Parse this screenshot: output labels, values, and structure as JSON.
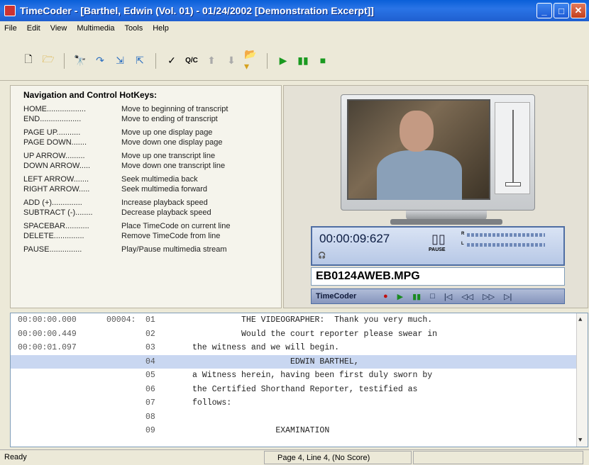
{
  "window": {
    "title": "TimeCoder - [Barthel, Edwin (Vol. 01) - 01/24/2002 [Demonstration Excerpt]]"
  },
  "menu": [
    "File",
    "Edit",
    "View",
    "Multimedia",
    "Tools",
    "Help"
  ],
  "toolbar_icons": [
    "new-document-icon",
    "open-folder-icon",
    "find-icon",
    "goto-icon",
    "next-icon",
    "prev-icon",
    "check-icon",
    "qc-icon",
    "up-arrow-icon",
    "down-arrow-icon",
    "folder-dropdown-icon",
    "play-icon",
    "pause-icon",
    "stop-icon"
  ],
  "toolbar": {
    "qc_label": "Q/C"
  },
  "navigation": {
    "title": "Navigation and Control HotKeys:",
    "groups": [
      [
        {
          "key": "HOME..................",
          "desc": "Move to beginning of transcript"
        },
        {
          "key": "END...................",
          "desc": "Move to ending of transcript"
        }
      ],
      [
        {
          "key": "PAGE UP...........",
          "desc": "Move up one display page"
        },
        {
          "key": "PAGE DOWN.......",
          "desc": "Move down one display page"
        }
      ],
      [
        {
          "key": "UP ARROW.........",
          "desc": "Move up one transcript line"
        },
        {
          "key": "DOWN ARROW.....",
          "desc": "Move down one transcript line"
        }
      ],
      [
        {
          "key": "LEFT ARROW.......",
          "desc": "Seek multimedia back"
        },
        {
          "key": "RIGHT ARROW.....",
          "desc": "Seek multimedia forward"
        }
      ],
      [
        {
          "key": "ADD (+)..............",
          "desc": "Increase playback speed"
        },
        {
          "key": "SUBTRACT (-)........",
          "desc": "Decrease playback speed"
        }
      ],
      [
        {
          "key": "SPACEBAR...........",
          "desc": "Place TimeCode on current line"
        },
        {
          "key": "DELETE..............",
          "desc": "Remove TimeCode from line"
        }
      ],
      [
        {
          "key": "PAUSE...............",
          "desc": "Play/Pause multimedia stream"
        }
      ]
    ]
  },
  "media": {
    "timecode": "00:00:09:627",
    "state": "PAUSE",
    "meter_r": "R",
    "meter_l": "L",
    "filename": "EB0124AWEB.MPG",
    "brand": "TimeCoder"
  },
  "transcript": {
    "lines": [
      {
        "tc": "00:00:00.000",
        "page": "00004:",
        "line": "01",
        "text": "          THE VIDEOGRAPHER:  Thank you very much.",
        "highlight": false
      },
      {
        "tc": "00:00:00.449",
        "page": "",
        "line": "02",
        "text": "          Would the court reporter please swear in",
        "highlight": false
      },
      {
        "tc": "00:00:01.097",
        "page": "",
        "line": "03",
        "text": "the witness and we will begin.",
        "highlight": false
      },
      {
        "tc": "",
        "page": "",
        "line": "04",
        "text": "                    EDWIN BARTHEL,",
        "highlight": true
      },
      {
        "tc": "",
        "page": "",
        "line": "05",
        "text": "a Witness herein, having been first duly sworn by",
        "highlight": false
      },
      {
        "tc": "",
        "page": "",
        "line": "06",
        "text": "the Certified Shorthand Reporter, testified as",
        "highlight": false
      },
      {
        "tc": "",
        "page": "",
        "line": "07",
        "text": "follows:",
        "highlight": false
      },
      {
        "tc": "",
        "page": "",
        "line": "08",
        "text": "",
        "highlight": false
      },
      {
        "tc": "",
        "page": "",
        "line": "09",
        "text": "                 EXAMINATION",
        "highlight": false
      }
    ]
  },
  "status": {
    "left": "Ready",
    "middle": "Page 4, Line 4, (No Score)",
    "right": ""
  }
}
